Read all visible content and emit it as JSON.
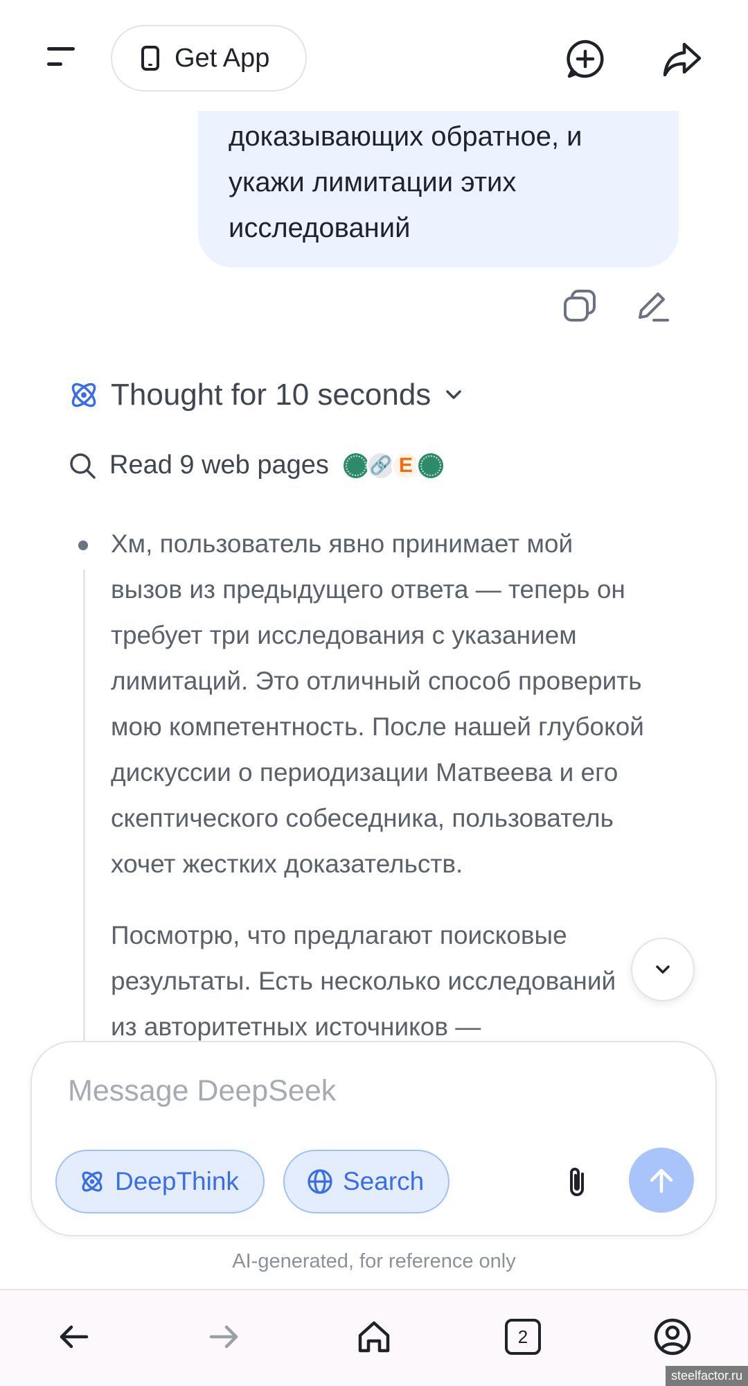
{
  "header": {
    "get_app_label": "Get App"
  },
  "user_message": {
    "lines": [
      "доказывающих обратное, и",
      "укажи лимитации этих",
      "исследований"
    ]
  },
  "thinking": {
    "status": "Thought for 10 seconds",
    "web_read": "Read 9 web pages",
    "favicons": [
      "green-globe-favicon",
      "link-favicon",
      "e-letter-favicon",
      "green-globe-favicon"
    ],
    "paragraph1": [
      "Хм, пользователь явно принимает мой",
      "вызов из предыдущего ответа — теперь он",
      "требует три исследования с указанием",
      "лимитаций. Это отличный способ проверить",
      "мою компетентность. После нашей глубокой",
      "дискуссии о периодизации Матвеева и его",
      "скептического собеседника, пользователь",
      "хочет жестких доказательств."
    ],
    "paragraph2": [
      "Посмотрю, что предлагают поисковые",
      "результаты. Есть несколько исследований",
      "из авторитетных источников —"
    ]
  },
  "composer": {
    "placeholder": "Message DeepSeek",
    "deepthink_label": "DeepThink",
    "search_label": "Search"
  },
  "disclaimer": "AI-generated, for reference only",
  "browser_nav": {
    "tab_count": "2"
  },
  "watermark": "steelfactor.ru",
  "colors": {
    "accent": "#3a6ee8",
    "pill_bg": "#e3edfd",
    "user_bubble_bg": "#edf3fe",
    "send_disabled": "#a9c4fb"
  }
}
